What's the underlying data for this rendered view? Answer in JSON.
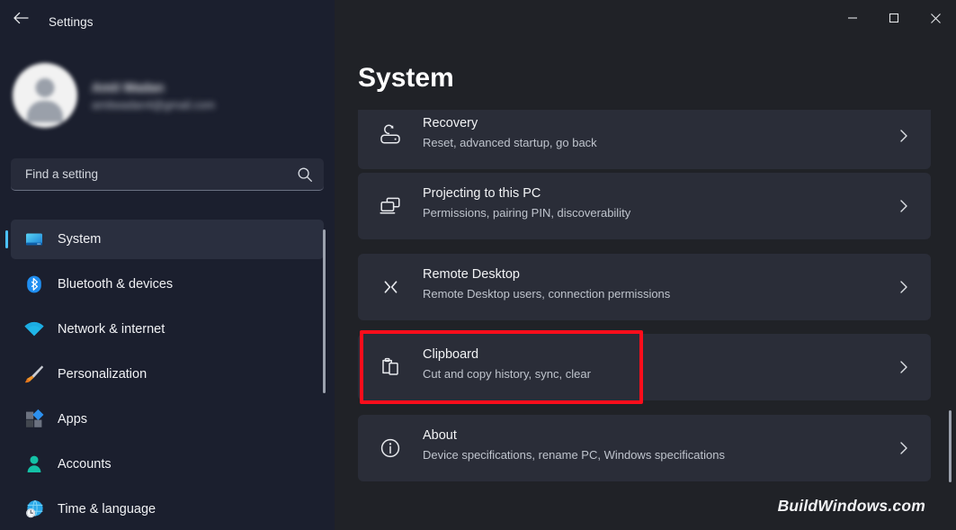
{
  "window": {
    "app_title": "Settings",
    "back_icon": "arrow-left-icon",
    "controls": [
      {
        "name": "minimize-button",
        "icon": "minimize-icon",
        "label": "—"
      },
      {
        "name": "maximize-button",
        "icon": "maximize-icon",
        "label": "□"
      },
      {
        "name": "close-button",
        "icon": "close-icon",
        "label": "✕"
      }
    ]
  },
  "account": {
    "avatar_icon": "user-avatar-icon",
    "name": "Amit Wadan",
    "email": "amitwadan4@gmail.com",
    "blurred": true
  },
  "search": {
    "placeholder": "Find a setting",
    "value": "",
    "icon": "search-icon"
  },
  "sidebar": {
    "items": [
      {
        "label": "System",
        "icon": "monitor-icon",
        "active": true
      },
      {
        "label": "Bluetooth & devices",
        "icon": "bluetooth-icon",
        "active": false
      },
      {
        "label": "Network & internet",
        "icon": "wifi-icon",
        "active": false
      },
      {
        "label": "Personalization",
        "icon": "paintbrush-icon",
        "active": false
      },
      {
        "label": "Apps",
        "icon": "apps-grid-icon",
        "active": false
      },
      {
        "label": "Accounts",
        "icon": "person-icon",
        "active": false
      },
      {
        "label": "Time & language",
        "icon": "globe-clock-icon",
        "active": false
      }
    ],
    "scrollbar": "sidebar-scrollbar"
  },
  "main": {
    "page_title": "System",
    "cards": [
      {
        "title": "Recovery",
        "subtitle": "Reset, advanced startup, go back",
        "icon": "recovery-icon",
        "chevron": "chevron-right-icon",
        "highlighted": false
      },
      {
        "title": "Projecting to this PC",
        "subtitle": "Permissions, pairing PIN, discoverability",
        "icon": "projecting-monitors-icon",
        "chevron": "chevron-right-icon",
        "highlighted": false
      },
      {
        "title": "Remote Desktop",
        "subtitle": "Remote Desktop users, connection permissions",
        "icon": "remote-desktop-icon",
        "chevron": "chevron-right-icon",
        "highlighted": false
      },
      {
        "title": "Clipboard",
        "subtitle": "Cut and copy history, sync, clear",
        "icon": "clipboard-icon",
        "chevron": "chevron-right-icon",
        "highlighted": true
      },
      {
        "title": "About",
        "subtitle": "Device specifications, rename PC, Windows specifications",
        "icon": "info-circle-icon",
        "chevron": "chevron-right-icon",
        "highlighted": false
      }
    ]
  },
  "watermark": "BuildWindows.com",
  "colors": {
    "sidebar_bg": "#1b1f2e",
    "content_bg": "#202227",
    "card_bg": "#2a2d38",
    "accent": "#4cc2ff",
    "highlight_red": "#fc0d1b",
    "text_primary": "#f2f3f5",
    "text_secondary": "#bfc4cd"
  }
}
